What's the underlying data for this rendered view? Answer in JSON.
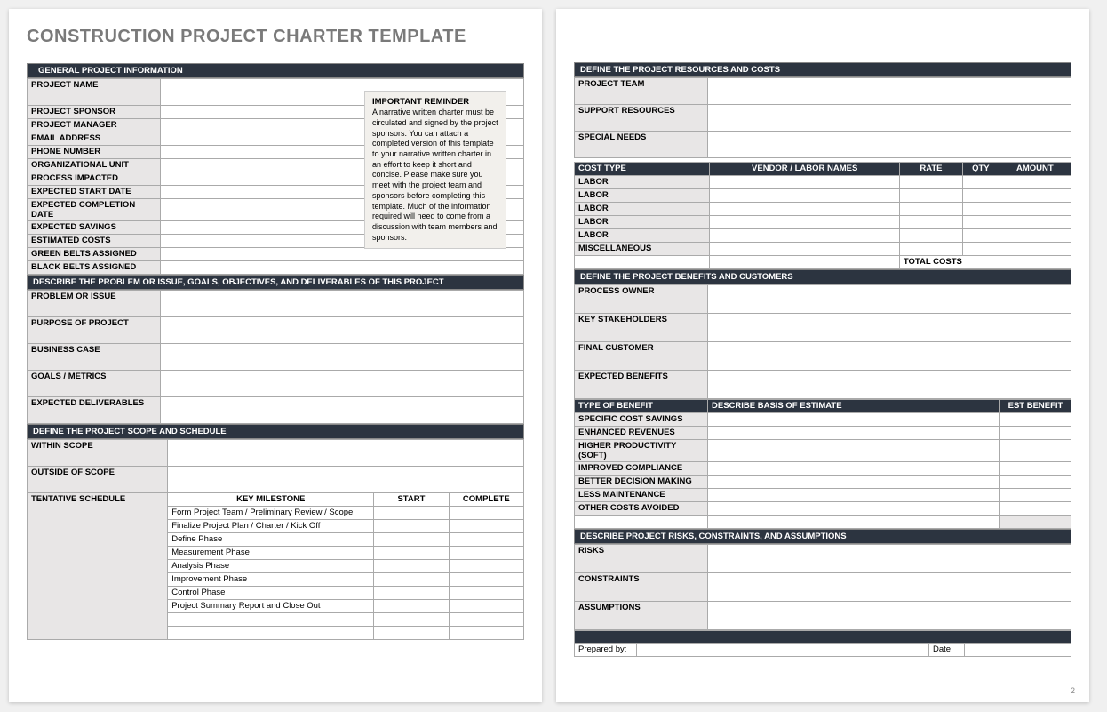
{
  "title": "CONSTRUCTION PROJECT CHARTER TEMPLATE",
  "reminder": {
    "heading": "IMPORTANT REMINDER",
    "body": "A narrative written charter must be circulated and signed by the project sponsors. You can attach a completed version of this template to your narrative written charter in an effort to keep it short and concise. Please make sure you meet with the project team and sponsors before completing this template. Much of the information required will need to come from a discussion with team members and sponsors."
  },
  "sections": {
    "general_info": "GENERAL PROJECT INFORMATION",
    "describe_problem": "DESCRIBE THE PROBLEM OR ISSUE, GOALS, OBJECTIVES, AND DELIVERABLES OF THIS PROJECT",
    "scope_schedule": "DEFINE THE PROJECT SCOPE AND SCHEDULE",
    "resources_costs": "DEFINE THE PROJECT RESOURCES AND COSTS",
    "benefits_customers": "DEFINE THE PROJECT BENEFITS AND CUSTOMERS",
    "risks": "DESCRIBE PROJECT RISKS, CONSTRAINTS, AND ASSUMPTIONS"
  },
  "labels": {
    "project_name": "PROJECT NAME",
    "project_sponsor": "PROJECT SPONSOR",
    "project_manager": "PROJECT MANAGER",
    "email_address": "EMAIL ADDRESS",
    "phone_number": "PHONE NUMBER",
    "org_unit": "ORGANIZATIONAL UNIT",
    "process_impacted": "PROCESS IMPACTED",
    "expected_start": "EXPECTED START DATE",
    "expected_complete": "EXPECTED COMPLETION DATE",
    "expected_savings": "EXPECTED SAVINGS",
    "estimated_costs": "ESTIMATED COSTS",
    "green_belts": "GREEN BELTS ASSIGNED",
    "black_belts": "BLACK BELTS ASSIGNED",
    "problem_issue": "PROBLEM OR ISSUE",
    "purpose": "PURPOSE OF PROJECT",
    "business_case": "BUSINESS CASE",
    "goals_metrics": "GOALS / METRICS",
    "expected_deliverables": "EXPECTED DELIVERABLES",
    "within_scope": "WITHIN SCOPE",
    "outside_scope": "OUTSIDE OF  SCOPE",
    "tentative_schedule": "TENTATIVE SCHEDULE",
    "key_milestone": "KEY MILESTONE",
    "start": "START",
    "complete": "COMPLETE",
    "project_team": "PROJECT TEAM",
    "support_resources": "SUPPORT RESOURCES",
    "special_needs": "SPECIAL NEEDS",
    "cost_type": "COST TYPE",
    "vendor_labor": "VENDOR / LABOR NAMES",
    "rate": "RATE",
    "qty": "QTY",
    "amount": "AMOUNT",
    "labor": "LABOR",
    "misc": "MISCELLANEOUS",
    "total_costs": "TOTAL COSTS",
    "process_owner": "PROCESS OWNER",
    "key_stakeholders": "KEY STAKEHOLDERS",
    "final_customer": "FINAL CUSTOMER",
    "expected_benefits": "EXPECTED BENEFITS",
    "type_of_benefit": "TYPE OF BENEFIT",
    "describe_basis": "DESCRIBE BASIS OF ESTIMATE",
    "est_benefit": "EST BENEFIT",
    "specific_savings": "SPECIFIC COST SAVINGS",
    "enhanced_revenues": "ENHANCED REVENUES",
    "higher_productivity": "HIGHER PRODUCTIVITY (SOFT)",
    "improved_compliance": "IMPROVED COMPLIANCE",
    "better_decision": "BETTER DECISION MAKING",
    "less_maintenance": "LESS MAINTENANCE",
    "other_costs": "OTHER COSTS AVOIDED",
    "risks_label": "RISKS",
    "constraints": "CONSTRAINTS",
    "assumptions": "ASSUMPTIONS",
    "prepared_by": "Prepared by:",
    "date": "Date:"
  },
  "milestones": [
    "Form Project Team / Preliminary Review / Scope",
    "Finalize Project Plan / Charter / Kick Off",
    "Define Phase",
    "Measurement Phase",
    "Analysis Phase",
    "Improvement Phase",
    "Control Phase",
    "Project Summary Report and Close Out"
  ],
  "page_number": "2"
}
